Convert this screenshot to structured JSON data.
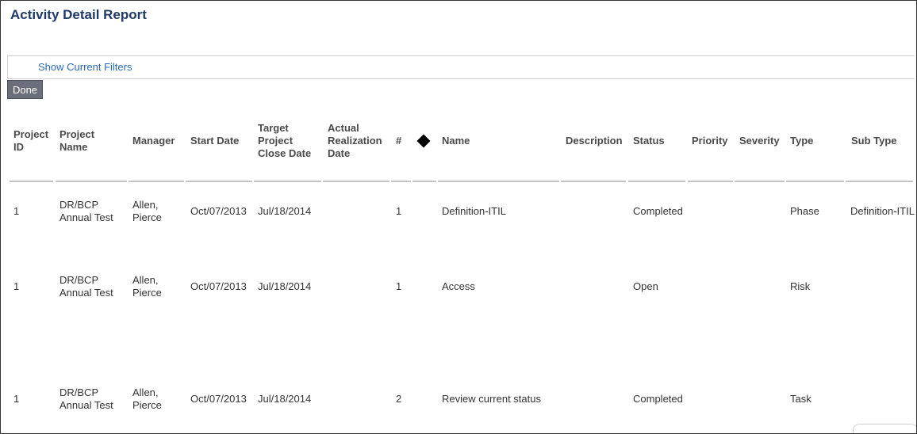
{
  "page": {
    "title": "Activity Detail Report"
  },
  "filters": {
    "show_label": "Show Current Filters"
  },
  "toolbar": {
    "done_label": "Done"
  },
  "table": {
    "headers": {
      "project_id": [
        "Project",
        "ID"
      ],
      "project_name": [
        "Project",
        "Name"
      ],
      "manager": [
        "Manager"
      ],
      "start_date": [
        "Start Date"
      ],
      "target_close": [
        "Target",
        "Project",
        "Close Date"
      ],
      "actual_realization": [
        "Actual",
        "Realization",
        "Date"
      ],
      "number": [
        "#"
      ],
      "milestone_icon": "diamond-icon",
      "name": [
        "Name"
      ],
      "description": [
        "Description"
      ],
      "status": [
        "Status"
      ],
      "priority": [
        "Priority"
      ],
      "severity": [
        "Severity"
      ],
      "type": [
        "Type"
      ],
      "sub_type": [
        "Sub Type"
      ]
    },
    "rows": [
      {
        "project_id": "1",
        "project_name": [
          "DR/BCP",
          "Annual Test"
        ],
        "manager": [
          "Allen,",
          "Pierce"
        ],
        "start_date": "Oct/07/2013",
        "target_close": "Jul/18/2014",
        "actual_realization": "",
        "number": "1",
        "name": "Definition-ITIL",
        "description": "",
        "status": "Completed",
        "priority": "",
        "severity": "",
        "type": "Phase",
        "sub_type": "Definition-ITIL"
      },
      {
        "project_id": "1",
        "project_name": [
          "DR/BCP",
          "Annual Test"
        ],
        "manager": [
          "Allen,",
          "Pierce"
        ],
        "start_date": "Oct/07/2013",
        "target_close": "Jul/18/2014",
        "actual_realization": "",
        "number": "1",
        "name": "Access",
        "description": "",
        "status": "Open",
        "priority": "",
        "severity": "",
        "type": "Risk",
        "sub_type": ""
      },
      {
        "project_id": "1",
        "project_name": [
          "DR/BCP",
          "Annual Test"
        ],
        "manager": [
          "Allen,",
          "Pierce"
        ],
        "start_date": "Oct/07/2013",
        "target_close": "Jul/18/2014",
        "actual_realization": "",
        "number": "2",
        "name": "Review current status",
        "description": "",
        "status": "Completed",
        "priority": "",
        "severity": "",
        "type": "Task",
        "sub_type": ""
      }
    ]
  }
}
